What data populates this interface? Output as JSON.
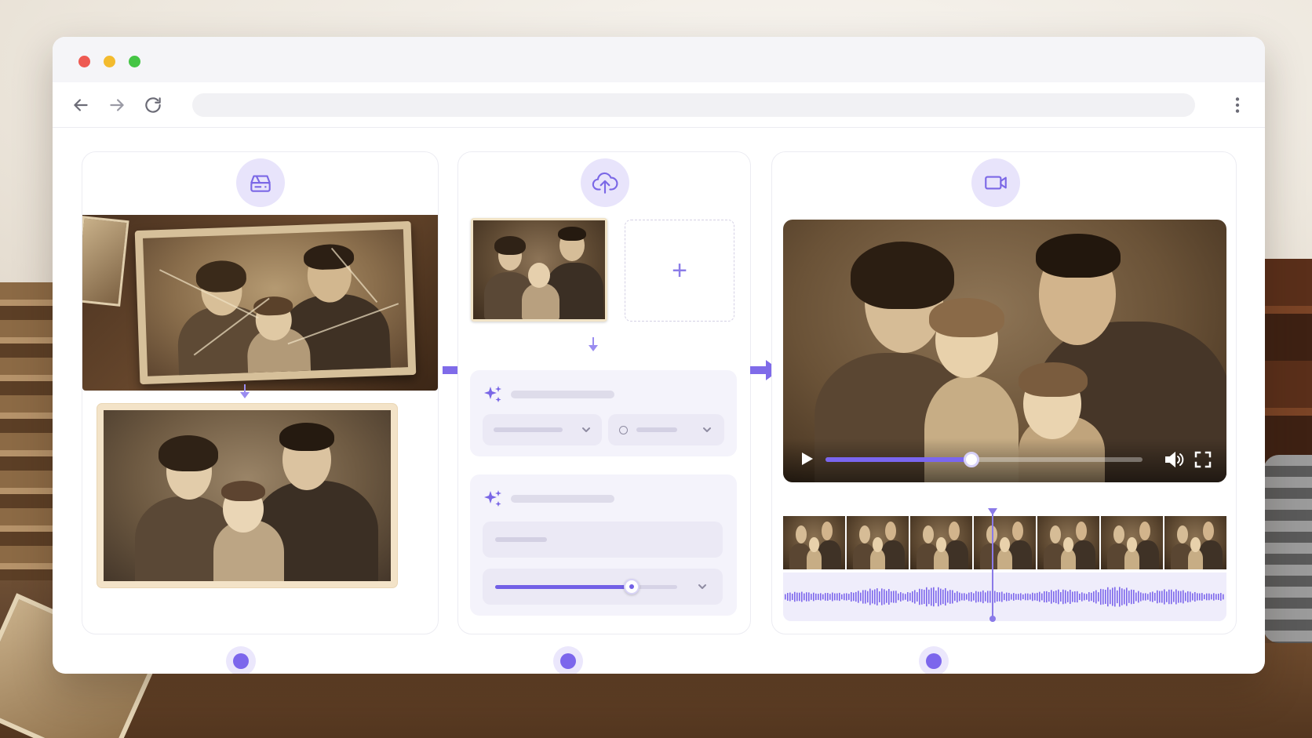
{
  "window": {
    "traffic_lights": [
      "close",
      "minimize",
      "maximize"
    ],
    "address_bar_value": ""
  },
  "toolbar": {
    "icons": [
      "arrow-left-icon",
      "arrow-right-icon",
      "reload-icon",
      "kebab-menu-icon"
    ]
  },
  "steps": [
    {
      "id": "scan",
      "icon": "scanner-icon"
    },
    {
      "id": "upload",
      "icon": "cloud-upload-icon"
    },
    {
      "id": "video",
      "icon": "video-camera-icon"
    }
  ],
  "upload": {
    "add_symbol": "+"
  },
  "ai_settings": {
    "sparkle_icon": "sparkle-icon",
    "slider_value": 0.75
  },
  "player": {
    "progress": 0.46,
    "playhead_position": 0.47,
    "filmstrip_frames": 7
  },
  "colors": {
    "accent": "#7c66ec",
    "accent_light": "#e8e4fb",
    "sepia": "#8e7556"
  }
}
